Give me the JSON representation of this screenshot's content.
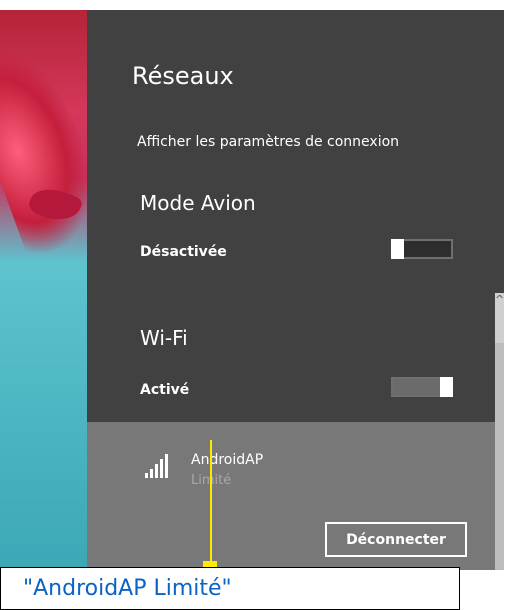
{
  "panel": {
    "title": "Réseaux",
    "settings_link": "Afficher les paramètres de connexion"
  },
  "airplane_mode": {
    "label": "Mode Avion",
    "state": "Désactivée",
    "on": false
  },
  "wifi": {
    "label": "Wi-Fi",
    "state": "Activé",
    "on": true
  },
  "network": {
    "name": "AndroidAP",
    "status": "Limité",
    "icon": "wifi-signal-icon",
    "disconnect_label": "Déconnecter"
  },
  "scrollbar": {
    "up_icon": "chevron-up-icon"
  },
  "annotation": {
    "text": "\"AndroidAP  Limité\"",
    "color": "#ffeb00",
    "text_color": "#0b63c4"
  }
}
